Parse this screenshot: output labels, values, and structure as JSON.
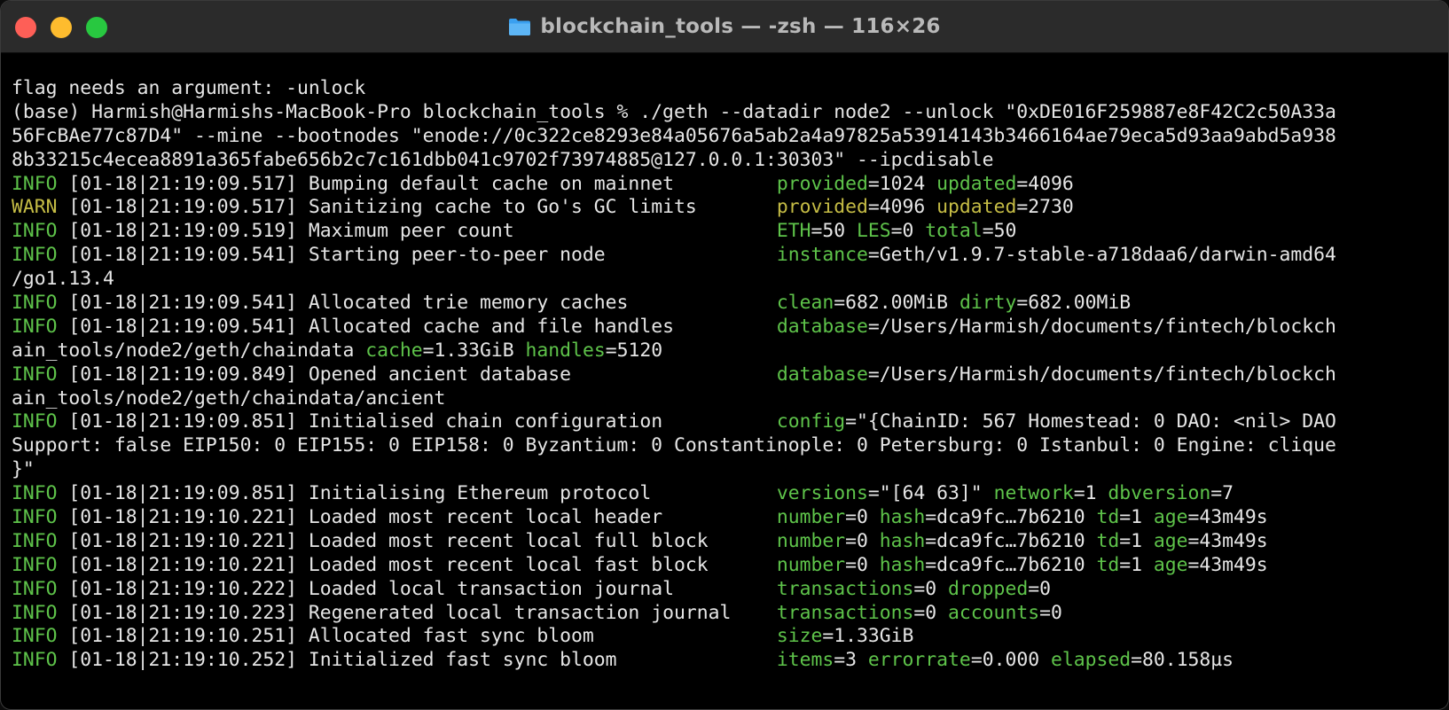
{
  "window": {
    "title": "blockchain_tools — -zsh — 116×26"
  },
  "terminal": {
    "lines": [
      {
        "type": "plain",
        "text": "flag needs an argument: -unlock"
      },
      {
        "type": "plain",
        "text": "(base) Harmish@Harmishs-MacBook-Pro blockchain_tools % ./geth --datadir node2 --unlock \"0xDE016F259887e8F42C2c50A33a"
      },
      {
        "type": "plain",
        "text": "56FcBAe77c87D4\" --mine --bootnodes \"enode://0c322ce8293e84a05676a5ab2a4a97825a53914143b3466164ae79eca5d93aa9abd5a938"
      },
      {
        "type": "plain",
        "text": "8b33215c4ecea8891a365fabe656b2c7c161dbb041c9702f73974885@127.0.0.1:30303\" --ipcdisable"
      },
      {
        "type": "log",
        "level": "INFO",
        "ts": " [01-18|21:19:09.517] ",
        "msg": "Bumping default cache on mainnet         ",
        "kv": [
          [
            "provided",
            "=1024 "
          ],
          [
            "updated",
            "=4096"
          ]
        ]
      },
      {
        "type": "log",
        "level": "WARN",
        "ts": " [01-18|21:19:09.517] ",
        "msg": "Sanitizing cache to Go's GC limits       ",
        "kv": [
          [
            "provided",
            "=4096 "
          ],
          [
            "updated",
            "=2730"
          ]
        ]
      },
      {
        "type": "log",
        "level": "INFO",
        "ts": " [01-18|21:19:09.519] ",
        "msg": "Maximum peer count                       ",
        "kv": [
          [
            "ETH",
            "=50 "
          ],
          [
            "LES",
            "=0 "
          ],
          [
            "total",
            "=50"
          ]
        ]
      },
      {
        "type": "log",
        "level": "INFO",
        "ts": " [01-18|21:19:09.541] ",
        "msg": "Starting peer-to-peer node               ",
        "kv": [
          [
            "instance",
            "=Geth/v1.9.7-stable-a718daa6/darwin-amd64"
          ]
        ]
      },
      {
        "type": "plain",
        "text": "/go1.13.4"
      },
      {
        "type": "log",
        "level": "INFO",
        "ts": " [01-18|21:19:09.541] ",
        "msg": "Allocated trie memory caches             ",
        "kv": [
          [
            "clean",
            "=682.00MiB "
          ],
          [
            "dirty",
            "=682.00MiB"
          ]
        ]
      },
      {
        "type": "log",
        "level": "INFO",
        "ts": " [01-18|21:19:09.541] ",
        "msg": "Allocated cache and file handles         ",
        "kv": [
          [
            "database",
            "=/Users/Harmish/documents/fintech/blockch"
          ]
        ]
      },
      {
        "type": "cont",
        "text": "ain_tools/node2/geth/chaindata ",
        "kv": [
          [
            "cache",
            "=1.33GiB "
          ],
          [
            "handles",
            "=5120"
          ]
        ]
      },
      {
        "type": "log",
        "level": "INFO",
        "ts": " [01-18|21:19:09.849] ",
        "msg": "Opened ancient database                  ",
        "kv": [
          [
            "database",
            "=/Users/Harmish/documents/fintech/blockch"
          ]
        ]
      },
      {
        "type": "plain",
        "text": "ain_tools/node2/geth/chaindata/ancient"
      },
      {
        "type": "log",
        "level": "INFO",
        "ts": " [01-18|21:19:09.851] ",
        "msg": "Initialised chain configuration          ",
        "kv": [
          [
            "config",
            "=\"{ChainID: 567 Homestead: 0 DAO: <nil> DAO"
          ]
        ]
      },
      {
        "type": "plain",
        "text": "Support: false EIP150: 0 EIP155: 0 EIP158: 0 Byzantium: 0 Constantinople: 0 Petersburg: 0 Istanbul: 0 Engine: clique"
      },
      {
        "type": "plain",
        "text": "}\""
      },
      {
        "type": "log",
        "level": "INFO",
        "ts": " [01-18|21:19:09.851] ",
        "msg": "Initialising Ethereum protocol           ",
        "kv": [
          [
            "versions",
            "=\"[64 63]\" "
          ],
          [
            "network",
            "=1 "
          ],
          [
            "dbversion",
            "=7"
          ]
        ]
      },
      {
        "type": "log",
        "level": "INFO",
        "ts": " [01-18|21:19:10.221] ",
        "msg": "Loaded most recent local header          ",
        "kv": [
          [
            "number",
            "=0 "
          ],
          [
            "hash",
            "=dca9fc…7b6210 "
          ],
          [
            "td",
            "=1 "
          ],
          [
            "age",
            "=43m49s"
          ]
        ]
      },
      {
        "type": "log",
        "level": "INFO",
        "ts": " [01-18|21:19:10.221] ",
        "msg": "Loaded most recent local full block      ",
        "kv": [
          [
            "number",
            "=0 "
          ],
          [
            "hash",
            "=dca9fc…7b6210 "
          ],
          [
            "td",
            "=1 "
          ],
          [
            "age",
            "=43m49s"
          ]
        ]
      },
      {
        "type": "log",
        "level": "INFO",
        "ts": " [01-18|21:19:10.221] ",
        "msg": "Loaded most recent local fast block      ",
        "kv": [
          [
            "number",
            "=0 "
          ],
          [
            "hash",
            "=dca9fc…7b6210 "
          ],
          [
            "td",
            "=1 "
          ],
          [
            "age",
            "=43m49s"
          ]
        ]
      },
      {
        "type": "log",
        "level": "INFO",
        "ts": " [01-18|21:19:10.222] ",
        "msg": "Loaded local transaction journal         ",
        "kv": [
          [
            "transactions",
            "=0 "
          ],
          [
            "dropped",
            "=0"
          ]
        ]
      },
      {
        "type": "log",
        "level": "INFO",
        "ts": " [01-18|21:19:10.223] ",
        "msg": "Regenerated local transaction journal    ",
        "kv": [
          [
            "transactions",
            "=0 "
          ],
          [
            "accounts",
            "=0"
          ]
        ]
      },
      {
        "type": "log",
        "level": "INFO",
        "ts": " [01-18|21:19:10.251] ",
        "msg": "Allocated fast sync bloom                ",
        "kv": [
          [
            "size",
            "=1.33GiB"
          ]
        ]
      },
      {
        "type": "log",
        "level": "INFO",
        "ts": " [01-18|21:19:10.252] ",
        "msg": "Initialized fast sync bloom              ",
        "kv": [
          [
            "items",
            "=3 "
          ],
          [
            "errorrate",
            "=0.000 "
          ],
          [
            "elapsed",
            "=80.158µs"
          ]
        ]
      }
    ]
  },
  "colors": {
    "info": "#5ec34a",
    "warn": "#c5bc45",
    "text": "#e6e6e6",
    "titlebar": "#2b2b2b",
    "close": "#fe5f57",
    "minimize": "#febc2e",
    "maximize": "#28c840",
    "folder": "#3aa0f0"
  },
  "icons": {
    "title_icon": "folder-icon"
  }
}
